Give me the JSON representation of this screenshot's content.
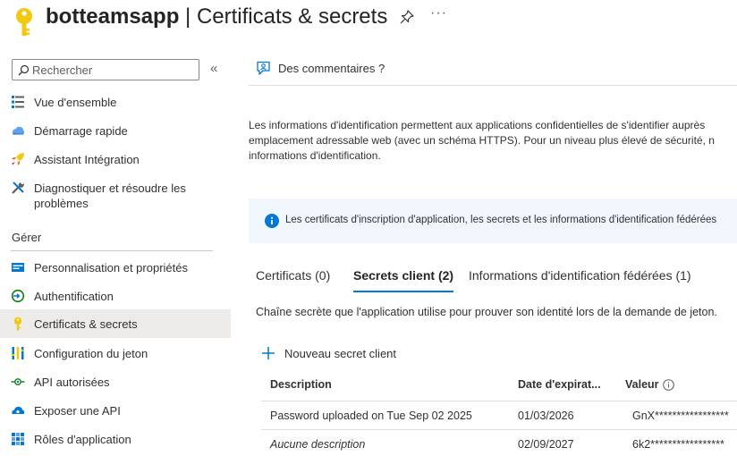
{
  "header": {
    "app_name": "botteamsapp",
    "separator": " | ",
    "page_title": "Certificats & secrets",
    "more": "···"
  },
  "sidebar": {
    "search_placeholder": "Rechercher",
    "collapse": "«",
    "items_top": [
      {
        "label": "Vue d'ensemble",
        "icon": "overview-icon"
      },
      {
        "label": "Démarrage rapide",
        "icon": "quickstart-icon"
      },
      {
        "label": "Assistant Intégration",
        "icon": "rocket-icon"
      },
      {
        "label": "Diagnostiquer et résoudre les problèmes",
        "icon": "wrench-icon"
      }
    ],
    "section_label": "Gérer",
    "items_manage": [
      {
        "label": "Personnalisation et propriétés",
        "icon": "branding-icon"
      },
      {
        "label": "Authentification",
        "icon": "authentication-icon"
      },
      {
        "label": "Certificats & secrets",
        "icon": "key-icon",
        "selected": true
      },
      {
        "label": "Configuration du jeton",
        "icon": "token-icon"
      },
      {
        "label": "API autorisées",
        "icon": "api-permissions-icon"
      },
      {
        "label": "Exposer une API",
        "icon": "cloud-icon"
      },
      {
        "label": "Rôles d'application",
        "icon": "app-roles-icon"
      }
    ]
  },
  "main": {
    "feedback_label": "Des commentaires ?",
    "intro_lines": [
      "Les informations d'identification permettent aux applications confidentielles de s'identifier auprès",
      "emplacement adressable web (avec un schéma HTTPS). Pour un niveau plus élevé de sécurité, n",
      "informations d'identification."
    ],
    "info_text": "Les certificats d'inscription d'application, les secrets et les informations d'identification fédérées",
    "tabs": [
      {
        "label": "Certificats (0)",
        "active": false
      },
      {
        "label": "Secrets client (2)",
        "active": true
      },
      {
        "label": "Informations d'identification fédérées (1)",
        "active": false
      }
    ],
    "tab_description": "Chaîne secrète que l'application utilise pour prouver son identité lors de la demande de jeton.",
    "new_secret_label": "Nouveau secret client",
    "table": {
      "columns": [
        "Description",
        "Date d'expirat...",
        "Valeur"
      ],
      "rows": [
        {
          "description": "Password uploaded on Tue Sep 02 2025",
          "expiry": "01/03/2026",
          "value": "GnX*****************",
          "italic": false
        },
        {
          "description": "Aucune description",
          "expiry": "02/09/2027",
          "value": "6k2*****************",
          "italic": true
        }
      ]
    }
  },
  "colors": {
    "accent": "#0078d4",
    "key_yellow": "#f2c811",
    "selected_bg": "#edebe9",
    "info_bg": "#f0f6fc"
  }
}
